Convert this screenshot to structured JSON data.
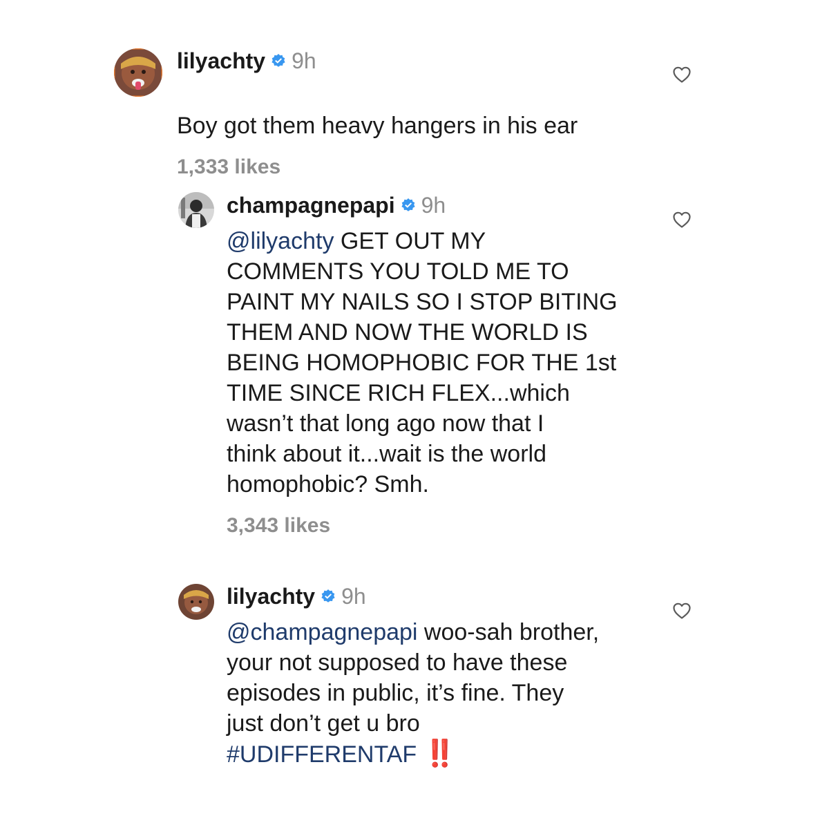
{
  "comments": [
    {
      "username": "lilyachty",
      "time": "9h",
      "text": "Boy got them heavy hangers in his ear",
      "likes": "1,333 likes",
      "avatar": "lilyachty-avatar",
      "verified_icon": "verified-badge-icon",
      "like_icon": "heart-icon"
    },
    {
      "username": "champagnepapi",
      "time": "9h",
      "mention": "@lilyachty",
      "text": " GET OUT MY\nCOMMENTS YOU TOLD ME TO\nPAINT MY NAILS SO I STOP BITING\nTHEM AND NOW THE WORLD IS\nBEING HOMOPHOBIC FOR THE 1st\nTIME SINCE RICH FLEX...which\nwasn’t that long ago now that I\nthink about it...wait is the world\nhomophobic? Smh.",
      "likes": "3,343 likes",
      "avatar": "champagnepapi-avatar",
      "verified_icon": "verified-badge-icon",
      "like_icon": "heart-icon"
    },
    {
      "username": "lilyachty",
      "time": "9h",
      "mention": "@champagnepapi",
      "text": " woo-sah brother,\nyour not supposed to have these\nepisodes in public, it’s fine. They\njust don’t get u bro\n",
      "hashtag": "#UDIFFERENTAF",
      "emoji": "‼️",
      "avatar": "lilyachty-avatar",
      "verified_icon": "verified-badge-icon",
      "like_icon": "heart-icon"
    }
  ],
  "colors": {
    "text": "#1a1a1a",
    "muted": "#8e8e8e",
    "mention": "#1f3b6b",
    "verified": "#3897f0",
    "emoji": "#d9261c"
  }
}
